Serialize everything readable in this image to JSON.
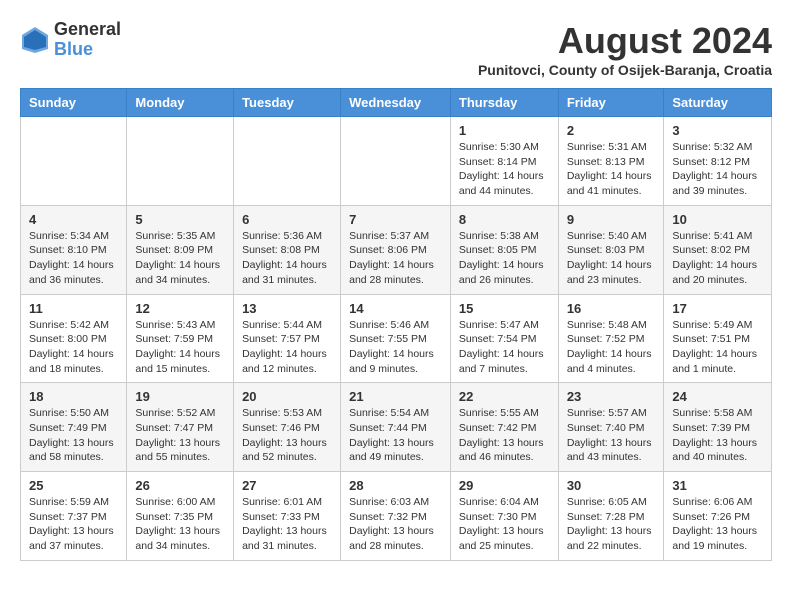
{
  "header": {
    "logo_general": "General",
    "logo_blue": "Blue",
    "month_year": "August 2024",
    "location": "Punitovci, County of Osijek-Baranja, Croatia"
  },
  "days_of_week": [
    "Sunday",
    "Monday",
    "Tuesday",
    "Wednesday",
    "Thursday",
    "Friday",
    "Saturday"
  ],
  "weeks": [
    [
      {
        "day": "",
        "info": ""
      },
      {
        "day": "",
        "info": ""
      },
      {
        "day": "",
        "info": ""
      },
      {
        "day": "",
        "info": ""
      },
      {
        "day": "1",
        "info": "Sunrise: 5:30 AM\nSunset: 8:14 PM\nDaylight: 14 hours\nand 44 minutes."
      },
      {
        "day": "2",
        "info": "Sunrise: 5:31 AM\nSunset: 8:13 PM\nDaylight: 14 hours\nand 41 minutes."
      },
      {
        "day": "3",
        "info": "Sunrise: 5:32 AM\nSunset: 8:12 PM\nDaylight: 14 hours\nand 39 minutes."
      }
    ],
    [
      {
        "day": "4",
        "info": "Sunrise: 5:34 AM\nSunset: 8:10 PM\nDaylight: 14 hours\nand 36 minutes."
      },
      {
        "day": "5",
        "info": "Sunrise: 5:35 AM\nSunset: 8:09 PM\nDaylight: 14 hours\nand 34 minutes."
      },
      {
        "day": "6",
        "info": "Sunrise: 5:36 AM\nSunset: 8:08 PM\nDaylight: 14 hours\nand 31 minutes."
      },
      {
        "day": "7",
        "info": "Sunrise: 5:37 AM\nSunset: 8:06 PM\nDaylight: 14 hours\nand 28 minutes."
      },
      {
        "day": "8",
        "info": "Sunrise: 5:38 AM\nSunset: 8:05 PM\nDaylight: 14 hours\nand 26 minutes."
      },
      {
        "day": "9",
        "info": "Sunrise: 5:40 AM\nSunset: 8:03 PM\nDaylight: 14 hours\nand 23 minutes."
      },
      {
        "day": "10",
        "info": "Sunrise: 5:41 AM\nSunset: 8:02 PM\nDaylight: 14 hours\nand 20 minutes."
      }
    ],
    [
      {
        "day": "11",
        "info": "Sunrise: 5:42 AM\nSunset: 8:00 PM\nDaylight: 14 hours\nand 18 minutes."
      },
      {
        "day": "12",
        "info": "Sunrise: 5:43 AM\nSunset: 7:59 PM\nDaylight: 14 hours\nand 15 minutes."
      },
      {
        "day": "13",
        "info": "Sunrise: 5:44 AM\nSunset: 7:57 PM\nDaylight: 14 hours\nand 12 minutes."
      },
      {
        "day": "14",
        "info": "Sunrise: 5:46 AM\nSunset: 7:55 PM\nDaylight: 14 hours\nand 9 minutes."
      },
      {
        "day": "15",
        "info": "Sunrise: 5:47 AM\nSunset: 7:54 PM\nDaylight: 14 hours\nand 7 minutes."
      },
      {
        "day": "16",
        "info": "Sunrise: 5:48 AM\nSunset: 7:52 PM\nDaylight: 14 hours\nand 4 minutes."
      },
      {
        "day": "17",
        "info": "Sunrise: 5:49 AM\nSunset: 7:51 PM\nDaylight: 14 hours\nand 1 minute."
      }
    ],
    [
      {
        "day": "18",
        "info": "Sunrise: 5:50 AM\nSunset: 7:49 PM\nDaylight: 13 hours\nand 58 minutes."
      },
      {
        "day": "19",
        "info": "Sunrise: 5:52 AM\nSunset: 7:47 PM\nDaylight: 13 hours\nand 55 minutes."
      },
      {
        "day": "20",
        "info": "Sunrise: 5:53 AM\nSunset: 7:46 PM\nDaylight: 13 hours\nand 52 minutes."
      },
      {
        "day": "21",
        "info": "Sunrise: 5:54 AM\nSunset: 7:44 PM\nDaylight: 13 hours\nand 49 minutes."
      },
      {
        "day": "22",
        "info": "Sunrise: 5:55 AM\nSunset: 7:42 PM\nDaylight: 13 hours\nand 46 minutes."
      },
      {
        "day": "23",
        "info": "Sunrise: 5:57 AM\nSunset: 7:40 PM\nDaylight: 13 hours\nand 43 minutes."
      },
      {
        "day": "24",
        "info": "Sunrise: 5:58 AM\nSunset: 7:39 PM\nDaylight: 13 hours\nand 40 minutes."
      }
    ],
    [
      {
        "day": "25",
        "info": "Sunrise: 5:59 AM\nSunset: 7:37 PM\nDaylight: 13 hours\nand 37 minutes."
      },
      {
        "day": "26",
        "info": "Sunrise: 6:00 AM\nSunset: 7:35 PM\nDaylight: 13 hours\nand 34 minutes."
      },
      {
        "day": "27",
        "info": "Sunrise: 6:01 AM\nSunset: 7:33 PM\nDaylight: 13 hours\nand 31 minutes."
      },
      {
        "day": "28",
        "info": "Sunrise: 6:03 AM\nSunset: 7:32 PM\nDaylight: 13 hours\nand 28 minutes."
      },
      {
        "day": "29",
        "info": "Sunrise: 6:04 AM\nSunset: 7:30 PM\nDaylight: 13 hours\nand 25 minutes."
      },
      {
        "day": "30",
        "info": "Sunrise: 6:05 AM\nSunset: 7:28 PM\nDaylight: 13 hours\nand 22 minutes."
      },
      {
        "day": "31",
        "info": "Sunrise: 6:06 AM\nSunset: 7:26 PM\nDaylight: 13 hours\nand 19 minutes."
      }
    ]
  ]
}
